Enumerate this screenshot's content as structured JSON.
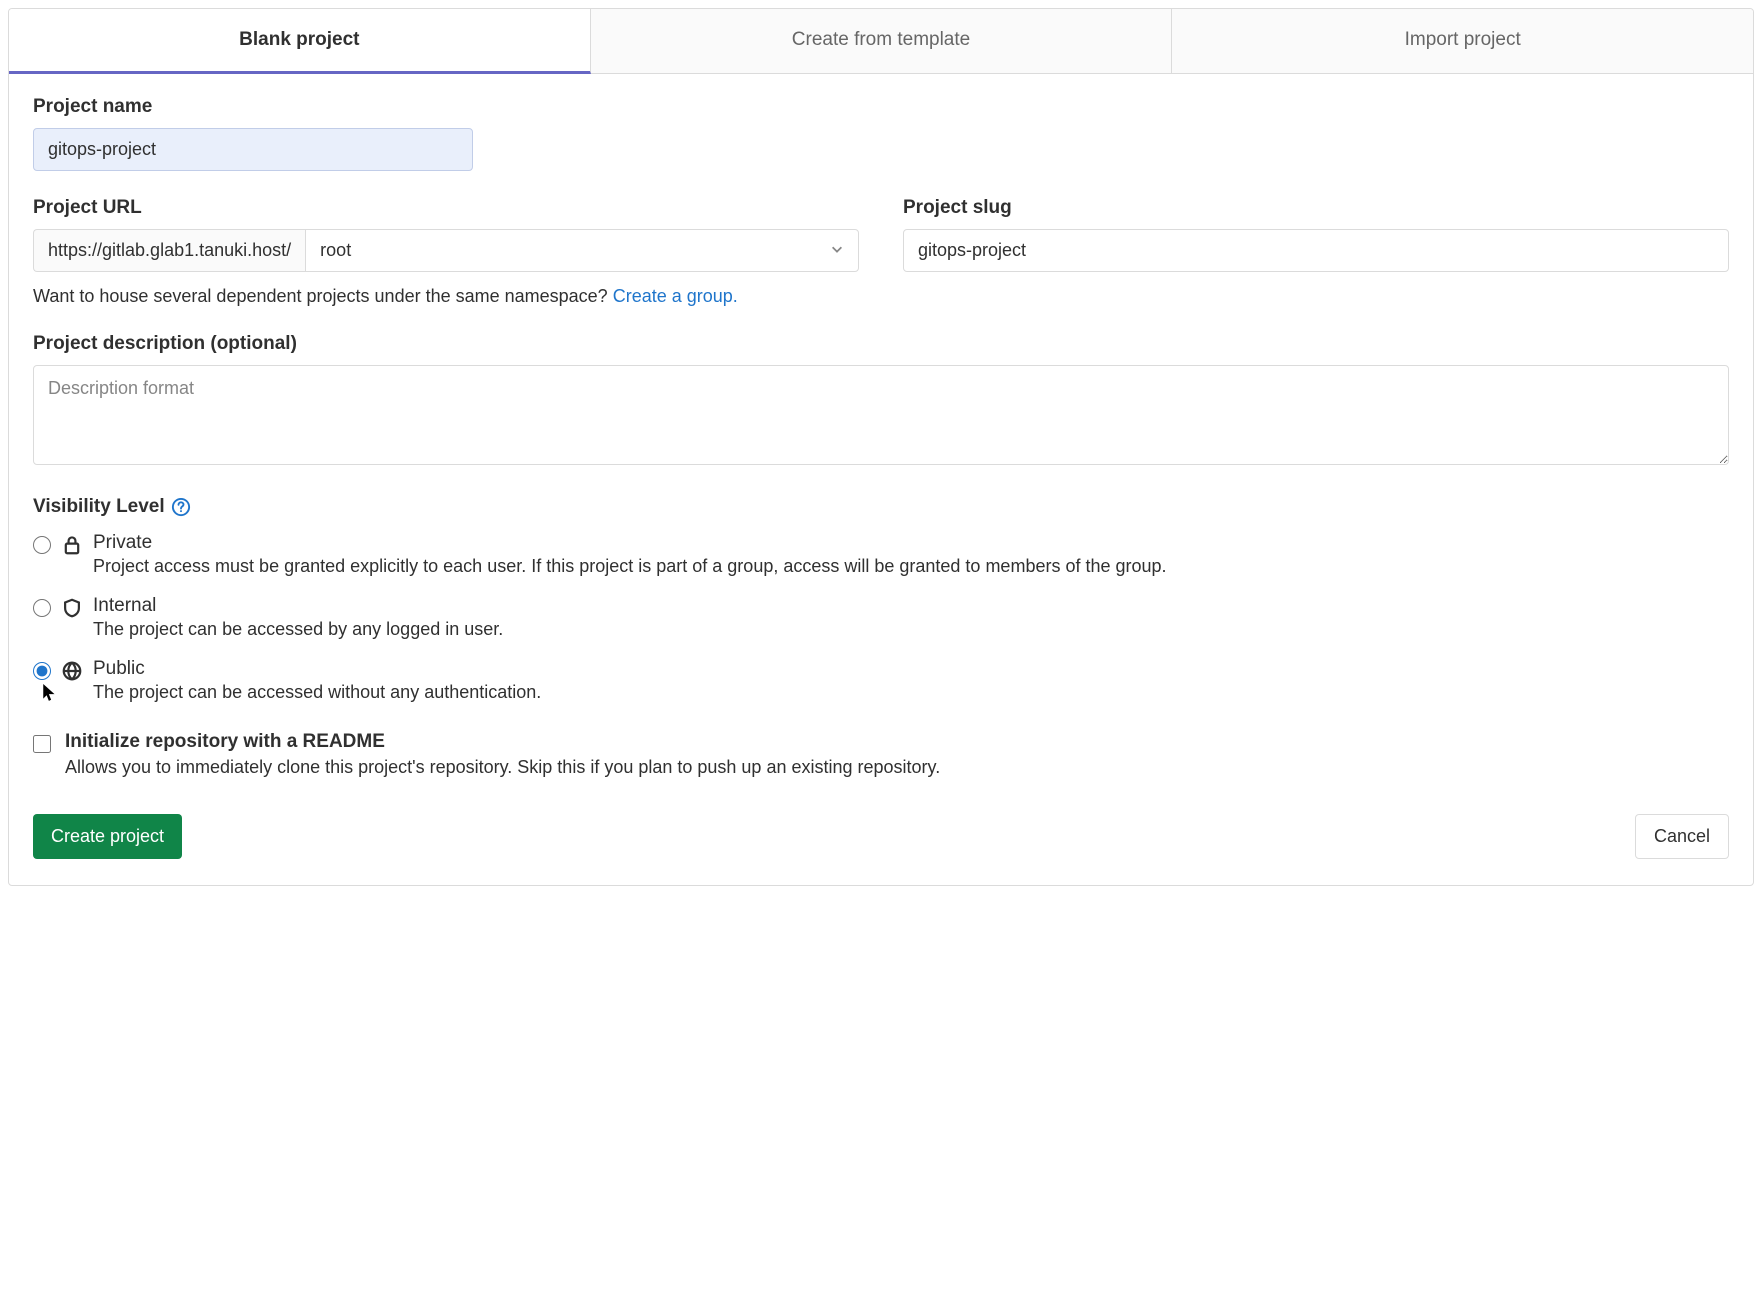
{
  "tabs": {
    "blank": "Blank project",
    "template": "Create from template",
    "import": "Import project"
  },
  "project_name": {
    "label": "Project name",
    "value": "gitops-project"
  },
  "project_url": {
    "label": "Project URL",
    "prefix": "https://gitlab.glab1.tanuki.host/",
    "namespace": "root"
  },
  "project_slug": {
    "label": "Project slug",
    "value": "gitops-project"
  },
  "namespace_hint": {
    "text": "Want to house several dependent projects under the same namespace? ",
    "link": "Create a group."
  },
  "description": {
    "label": "Project description (optional)",
    "placeholder": "Description format"
  },
  "visibility": {
    "label": "Visibility Level",
    "options": {
      "private": {
        "title": "Private",
        "desc": "Project access must be granted explicitly to each user. If this project is part of a group, access will be granted to members of the group."
      },
      "internal": {
        "title": "Internal",
        "desc": "The project can be accessed by any logged in user."
      },
      "public": {
        "title": "Public",
        "desc": "The project can be accessed without any authentication."
      }
    },
    "selected": "public"
  },
  "readme": {
    "title": "Initialize repository with a README",
    "desc": "Allows you to immediately clone this project's repository. Skip this if you plan to push up an existing repository.",
    "checked": false
  },
  "actions": {
    "create": "Create project",
    "cancel": "Cancel"
  }
}
